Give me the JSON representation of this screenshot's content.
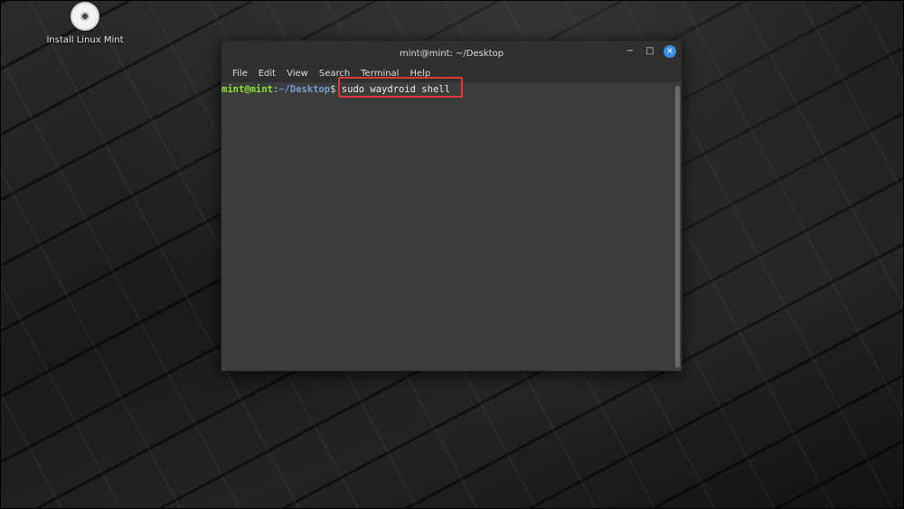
{
  "desktop": {
    "icon_label": "Install Linux Mint"
  },
  "terminal": {
    "title": "mint@mint: ~/Desktop",
    "menu": [
      "File",
      "Edit",
      "View",
      "Search",
      "Terminal",
      "Help"
    ],
    "prompt_user": "mint@mint",
    "prompt_colon": ":",
    "prompt_path": "~/Desktop",
    "prompt_dollar": "$ ",
    "command": "sudo waydroid shell",
    "controls": {
      "minimize": "−",
      "maximize": "□",
      "close": "×"
    }
  },
  "colors": {
    "prompt_user": "#8ae234",
    "prompt_path": "#729fcf",
    "highlight": "#e2363b",
    "close_button": "#3b8ee0"
  }
}
